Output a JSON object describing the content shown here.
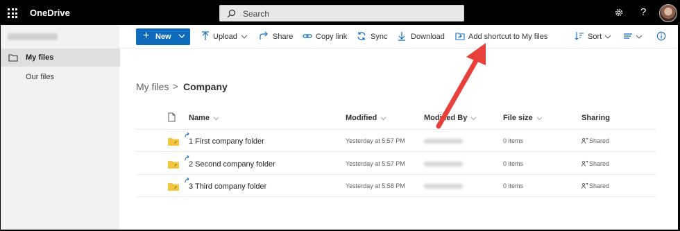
{
  "app": {
    "title": "OneDrive"
  },
  "search": {
    "placeholder": "Search"
  },
  "nav": {
    "items": [
      {
        "label": "My files",
        "active": true
      },
      {
        "label": "Our files",
        "active": false
      }
    ]
  },
  "commands": {
    "new": "New",
    "upload": "Upload",
    "share": "Share",
    "copy_link": "Copy link",
    "sync": "Sync",
    "download": "Download",
    "add_shortcut": "Add shortcut to My files",
    "sort": "Sort"
  },
  "breadcrumb": {
    "root": "My files",
    "separator": ">",
    "current": "Company"
  },
  "table": {
    "headers": {
      "name": "Name",
      "modified": "Modified",
      "modified_by": "Modified By",
      "file_size": "File size",
      "sharing": "Sharing"
    },
    "rows": [
      {
        "name": "1 First company folder",
        "modified": "Yesterday at 5:57 PM",
        "size": "0 items",
        "sharing": "Shared"
      },
      {
        "name": "2 Second company folder",
        "modified": "Yesterday at 5:57 PM",
        "size": "0 items",
        "sharing": "Shared"
      },
      {
        "name": "3 Third company folder",
        "modified": "Yesterday at 5:58 PM",
        "size": "0 items",
        "sharing": "Shared"
      }
    ]
  },
  "colors": {
    "accent": "#0f6cbd",
    "arrow": "#e8403b",
    "folder": "#f4c542",
    "topbar": "#000000"
  },
  "icons": [
    "waffle-icon",
    "search-icon",
    "gear-icon",
    "help-icon",
    "folder-icon",
    "upload-icon",
    "share-icon",
    "link-icon",
    "sync-icon",
    "download-icon",
    "shortcut-icon",
    "sort-icon",
    "view-icon",
    "info-icon",
    "file-icon",
    "shared-icon"
  ]
}
